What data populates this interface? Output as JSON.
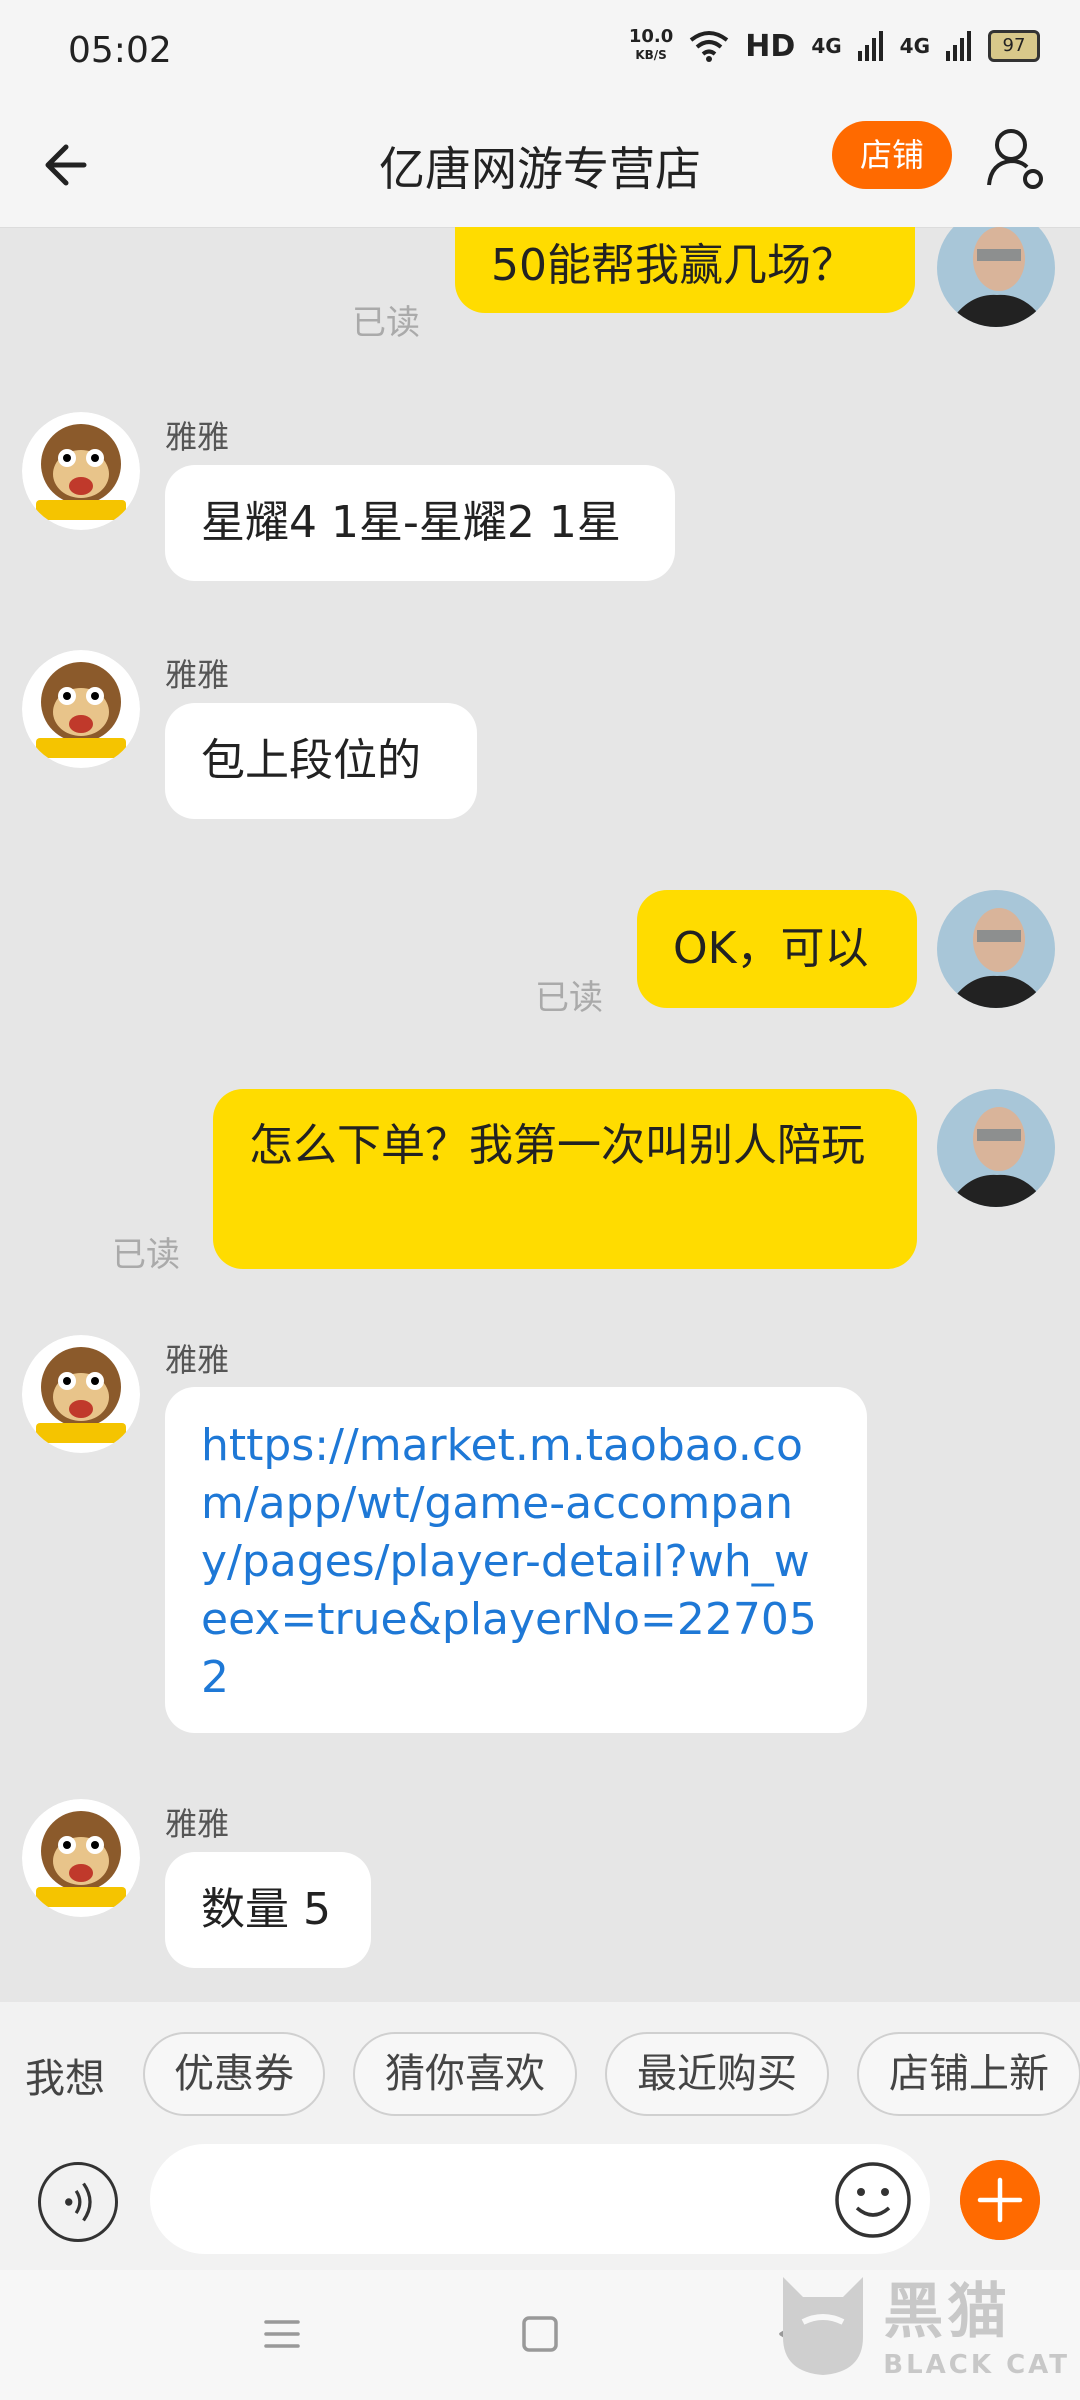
{
  "status_bar": {
    "time": "05:02",
    "net_speed_value": "10.0",
    "net_speed_unit": "KB/S",
    "hd_label": "HD",
    "signal_1_label": "4G",
    "signal_2_label": "4G",
    "battery_level": "97"
  },
  "header": {
    "title": "亿唐网游专营店",
    "shop_button_label": "店铺"
  },
  "messages": [
    {
      "from": "me",
      "text": "50能帮我赢几场？",
      "read_label": "已读"
    },
    {
      "from": "them",
      "sender": "雅雅",
      "text": "星耀4 1星-星耀2 1星"
    },
    {
      "from": "them",
      "sender": "雅雅",
      "text": "包上段位的"
    },
    {
      "from": "me",
      "text": "OK，可以",
      "read_label": "已读"
    },
    {
      "from": "me",
      "text": "怎么下单？我第一次叫别人陪玩",
      "read_label": "已读"
    },
    {
      "from": "them",
      "sender": "雅雅",
      "link": "https://market.m.taobao.com/app/wt/game-accompany/pages/player-detail?wh_weex=true&playerNo=227052"
    },
    {
      "from": "them",
      "sender": "雅雅",
      "text": "数量 5"
    }
  ],
  "quick_bar": {
    "label": "我想",
    "chips": [
      "优惠券",
      "猜你喜欢",
      "最近购买",
      "店铺上新"
    ]
  },
  "input": {
    "placeholder": ""
  },
  "watermark": {
    "big_text": "黑猫",
    "small_text": "BLACK CAT"
  },
  "colors": {
    "accent": "#ff6a00",
    "my_bubble": "#ffdc00",
    "link": "#1e78d6",
    "chat_bg": "#e6e6e6"
  }
}
